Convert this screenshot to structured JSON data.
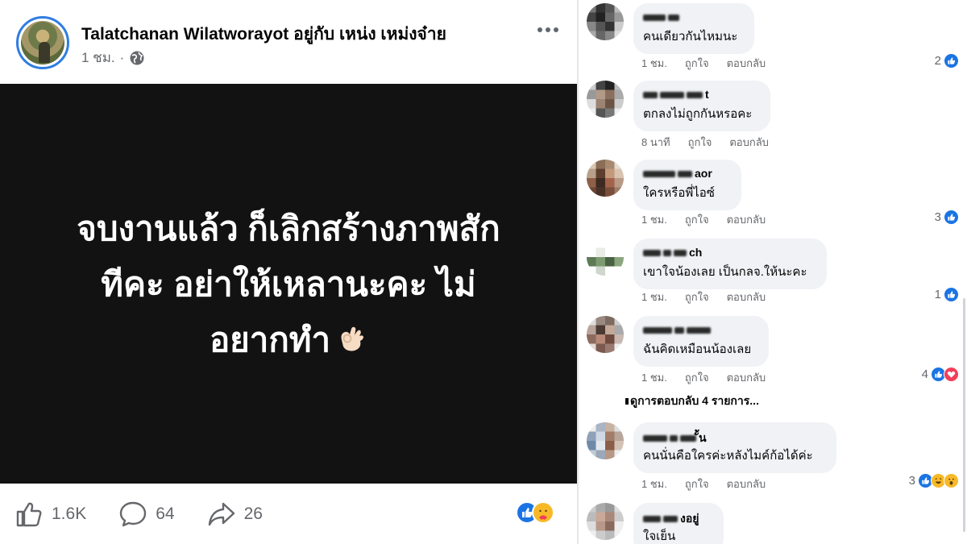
{
  "post": {
    "author": "Talatchanan Wilatworayot",
    "with_text": "อยู่กับ เหน่ง เหม่งจ๋าย",
    "time": "1 ชม.",
    "separator": "·",
    "image_text_lines": [
      "จบงานแล้ว ก็เลิกสร้างภาพสัก",
      "ทีคะ อย่าให้เหลานะคะ ไม่",
      "อยากทำ"
    ],
    "image_emoji": "ok-hand-emoji",
    "likes": "1.6K",
    "comments": "64",
    "shares": "26",
    "reaction_icons": [
      "like-icon",
      "care-icon"
    ]
  },
  "comments": [
    {
      "name_suffix": "",
      "text": "คนเดียวกันไหมนะ",
      "time": "1 ชม.",
      "count": "2",
      "reactions": [
        "like"
      ]
    },
    {
      "name_suffix": "t",
      "text": "ตกลงไม่ถูกกันหรอคะ",
      "time": "8 นาที",
      "count": "",
      "reactions": []
    },
    {
      "name_suffix": "aor",
      "text": "ใครหรือพี่ไอซ์",
      "time": "1 ชม.",
      "count": "3",
      "reactions": [
        "like"
      ]
    },
    {
      "name_suffix": "ch",
      "text": "เขาใจน้องเลย เป็นกลจ.ให้นะคะ",
      "time": "1 ชม.",
      "count": "1",
      "reactions": [
        "like"
      ]
    },
    {
      "name_suffix": "",
      "text": "ฉันคิดเหมือนน้องเลย",
      "time": "1 ชม.",
      "count": "4",
      "reactions": [
        "like",
        "love"
      ]
    },
    {
      "name_suffix": "ั้น",
      "text": "คนนั่นคือใครค่ะหลังไมค์ก้อได้ค่ะ",
      "time": "1 ชม.",
      "count": "3",
      "reactions": [
        "like",
        "haha",
        "wow"
      ]
    },
    {
      "name_suffix": "งอยู่",
      "text": "ใจเย็น",
      "time": "",
      "count": "",
      "reactions": []
    }
  ],
  "labels": {
    "like": "ถูกใจ",
    "reply": "ตอบกลับ",
    "see_replies": "ดูการตอบกลับ 4 รายการ..."
  },
  "colors": {
    "facebook_blue": "#1b74e4",
    "image_bg": "#121212",
    "bubble_bg": "#f0f2f5",
    "meta_gray": "#65676b"
  }
}
